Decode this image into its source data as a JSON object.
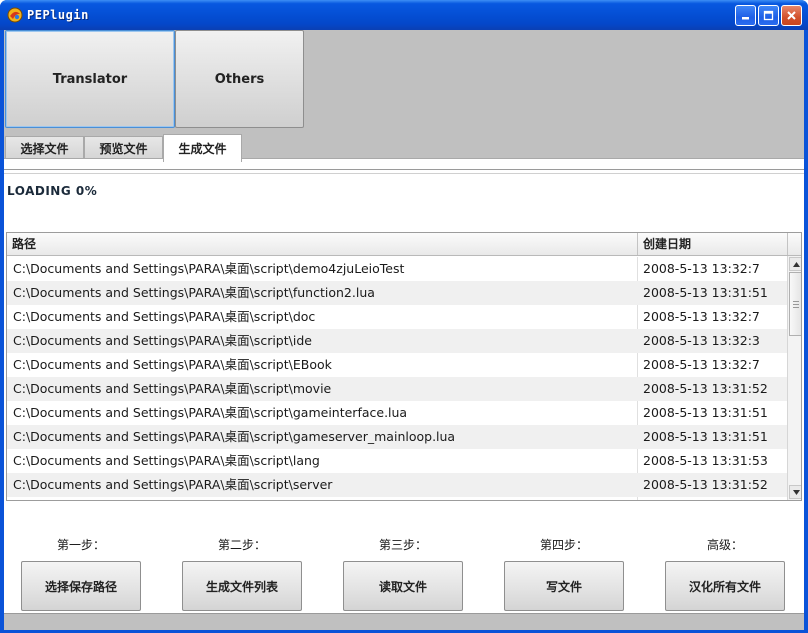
{
  "window": {
    "title": "PEPlugin"
  },
  "top_buttons": [
    {
      "label": "Translator",
      "active": true
    },
    {
      "label": "Others",
      "active": false
    }
  ],
  "tabs": [
    {
      "label": "选择文件",
      "selected": false
    },
    {
      "label": "预览文件",
      "selected": false
    },
    {
      "label": "生成文件",
      "selected": true
    }
  ],
  "status": {
    "loading": "LOADING 0%"
  },
  "table": {
    "columns": [
      "路径",
      "创建日期"
    ],
    "rows": [
      {
        "path": "C:\\Documents and Settings\\PARA\\桌面\\script\\demo4zjuLeioTest",
        "date": "2008-5-13 13:32:7"
      },
      {
        "path": "C:\\Documents and Settings\\PARA\\桌面\\script\\function2.lua",
        "date": "2008-5-13 13:31:51"
      },
      {
        "path": "C:\\Documents and Settings\\PARA\\桌面\\script\\doc",
        "date": "2008-5-13 13:32:7"
      },
      {
        "path": "C:\\Documents and Settings\\PARA\\桌面\\script\\ide",
        "date": "2008-5-13 13:32:3"
      },
      {
        "path": "C:\\Documents and Settings\\PARA\\桌面\\script\\EBook",
        "date": "2008-5-13 13:32:7"
      },
      {
        "path": "C:\\Documents and Settings\\PARA\\桌面\\script\\movie",
        "date": "2008-5-13 13:31:52"
      },
      {
        "path": "C:\\Documents and Settings\\PARA\\桌面\\script\\gameinterface.lua",
        "date": "2008-5-13 13:31:51"
      },
      {
        "path": "C:\\Documents and Settings\\PARA\\桌面\\script\\gameserver_mainloop.lua",
        "date": "2008-5-13 13:31:51"
      },
      {
        "path": "C:\\Documents and Settings\\PARA\\桌面\\script\\lang",
        "date": "2008-5-13 13:31:53"
      },
      {
        "path": "C:\\Documents and Settings\\PARA\\桌面\\script\\server",
        "date": "2008-5-13 13:31:52"
      }
    ]
  },
  "steps": [
    {
      "label": "第一步：",
      "button": "选择保存路径"
    },
    {
      "label": "第二步：",
      "button": "生成文件列表"
    },
    {
      "label": "第三步：",
      "button": "读取文件"
    },
    {
      "label": "第四步：",
      "button": "写文件"
    },
    {
      "label": "高级：",
      "button": "汉化所有文件"
    }
  ],
  "icons": {
    "app": "app-icon",
    "minimize": "minimize-icon",
    "maximize": "maximize-icon",
    "close": "close-icon",
    "scroll_up": "scroll-up-icon",
    "scroll_down": "scroll-down-icon"
  },
  "colors": {
    "titlebar": "#0550d6",
    "client": "#c0c0c0",
    "close_button": "#d2512b"
  }
}
